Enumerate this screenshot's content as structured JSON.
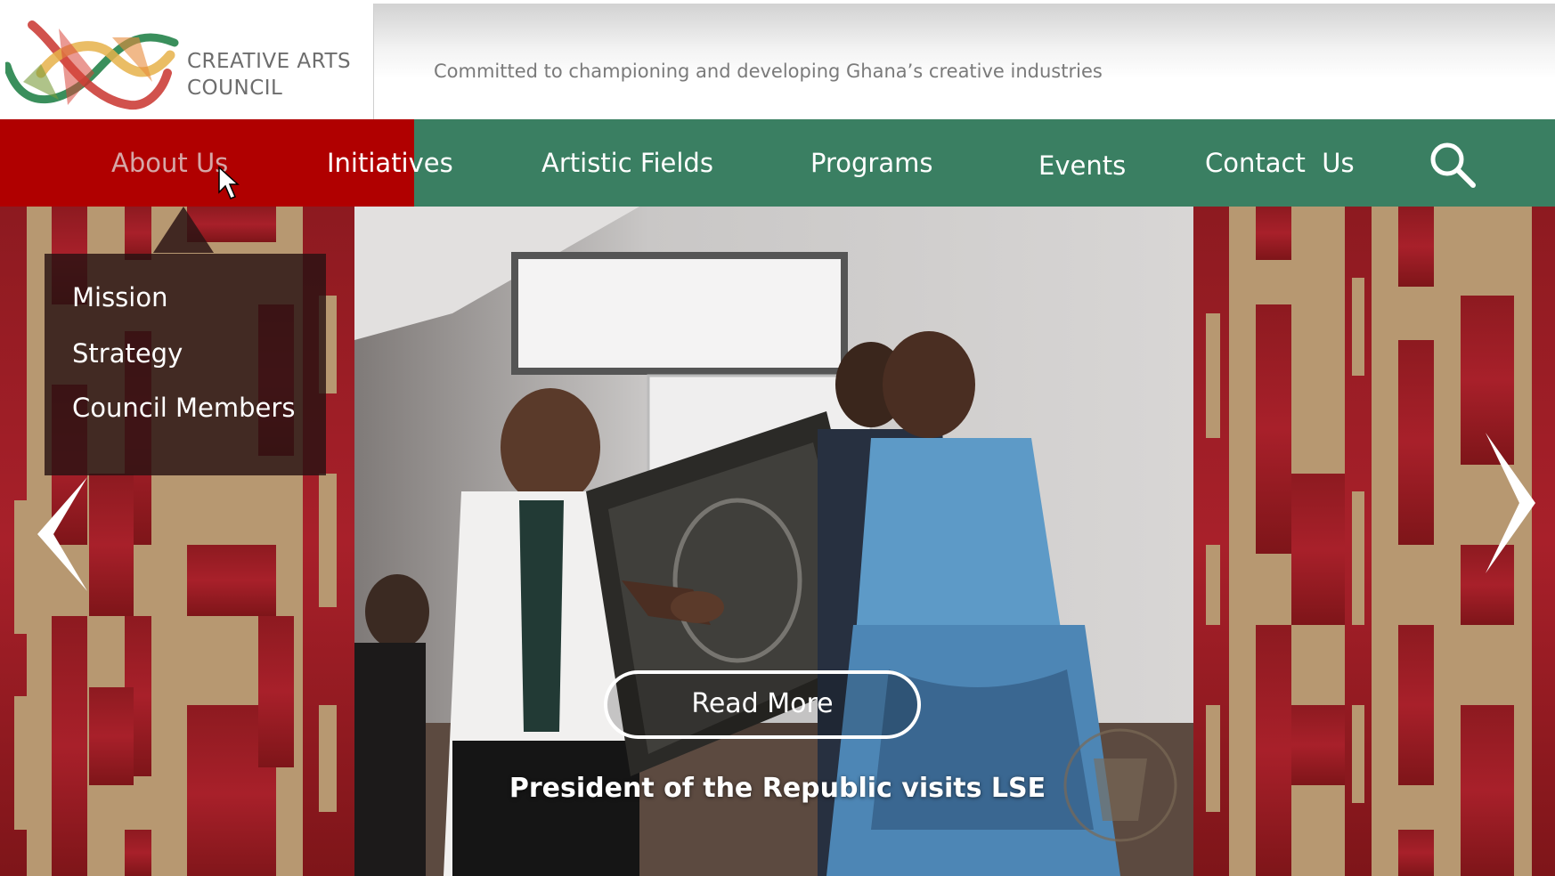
{
  "header": {
    "logo": {
      "line1": "CREATIVE ARTS",
      "line2": "COUNCIL"
    },
    "tagline": "Committed to championing and developing Ghana’s creative industries"
  },
  "nav": {
    "items": [
      {
        "label": "About Us",
        "active": true
      },
      {
        "label": "Initiatives"
      },
      {
        "label": "Artistic Fields"
      },
      {
        "label": "Programs"
      },
      {
        "label": "Events"
      },
      {
        "label": "Contact  Us"
      }
    ],
    "search_icon": "search-icon"
  },
  "dropdown": {
    "items": [
      "Mission",
      "Strategy",
      "Council Members"
    ]
  },
  "hero": {
    "read_more_label": "Read More",
    "caption": "President of the Republic visits LSE",
    "prev_icon": "chevron-left-icon",
    "next_icon": "chevron-right-icon"
  },
  "colors": {
    "nav_green": "#3a7f62",
    "nav_active_red": "#b00000",
    "kente_red": "#9e1b22",
    "kente_gold": "#b8976a",
    "dropdown_bg": "#281212"
  }
}
